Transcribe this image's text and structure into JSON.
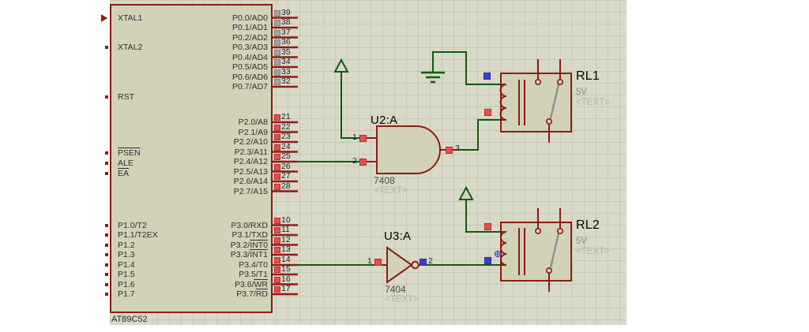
{
  "chip": {
    "part_label": "AT89C52",
    "left_pins": [
      {
        "label": "XTAL1"
      },
      {
        "label": "XTAL2"
      },
      {
        "label": "RST"
      },
      {
        "label": "PSEN"
      },
      {
        "label": "ALE"
      },
      {
        "label": "EA"
      },
      {
        "label": "P1.0/T2"
      },
      {
        "label": "P1.1/T2EX"
      },
      {
        "label": "P1.2"
      },
      {
        "label": "P1.3"
      },
      {
        "label": "P1.4"
      },
      {
        "label": "P1.5"
      },
      {
        "label": "P1.6"
      },
      {
        "label": "P1.7"
      }
    ],
    "right_pins": [
      {
        "num": "39",
        "pre": "P0.0/AD0",
        "ovl": ""
      },
      {
        "num": "38",
        "pre": "P0.1/AD1",
        "ovl": ""
      },
      {
        "num": "37",
        "pre": "P0.2/AD2",
        "ovl": ""
      },
      {
        "num": "36",
        "pre": "P0.3/AD3",
        "ovl": ""
      },
      {
        "num": "35",
        "pre": "P0.4/AD4",
        "ovl": ""
      },
      {
        "num": "34",
        "pre": "P0.5/AD5",
        "ovl": ""
      },
      {
        "num": "33",
        "pre": "P0.6/AD6",
        "ovl": ""
      },
      {
        "num": "32",
        "pre": "P0.7/AD7",
        "ovl": ""
      },
      {
        "num": "21",
        "pre": "P2.0/A8",
        "ovl": ""
      },
      {
        "num": "22",
        "pre": "P2.1/A9",
        "ovl": ""
      },
      {
        "num": "23",
        "pre": "P2.2/A10",
        "ovl": ""
      },
      {
        "num": "24",
        "pre": "P2.3/A11",
        "ovl": ""
      },
      {
        "num": "25",
        "pre": "P2.4/A12",
        "ovl": ""
      },
      {
        "num": "26",
        "pre": "P2.5/A13",
        "ovl": ""
      },
      {
        "num": "27",
        "pre": "P2.6/A14",
        "ovl": ""
      },
      {
        "num": "28",
        "pre": "P2.7/A15",
        "ovl": ""
      },
      {
        "num": "10",
        "pre": "P3.0/RXD",
        "ovl": ""
      },
      {
        "num": "11",
        "pre": "P3.1/TXD",
        "ovl": ""
      },
      {
        "num": "12",
        "pre": "P3.2/",
        "ovl": "INT0"
      },
      {
        "num": "13",
        "pre": "P3.3/",
        "ovl": "INT1"
      },
      {
        "num": "14",
        "pre": "P3.4/T0",
        "ovl": ""
      },
      {
        "num": "15",
        "pre": "P3.5/T1",
        "ovl": ""
      },
      {
        "num": "16",
        "pre": "P3.6/",
        "ovl": "WR"
      },
      {
        "num": "17",
        "pre": "P3.7/",
        "ovl": "RD"
      }
    ]
  },
  "gates": {
    "u2": {
      "ref": "U2:A",
      "part": "7408",
      "placeholder": "<TEXT>",
      "pin1": "1",
      "pin2": "2",
      "pin3": "3"
    },
    "u3": {
      "ref": "U3:A",
      "part": "7404",
      "placeholder": "<TEXT>",
      "pin1": "1",
      "pin2": "2"
    }
  },
  "relays": {
    "rl1": {
      "ref": "RL1",
      "voltage": "5V",
      "placeholder": "<TEXT>"
    },
    "rl2": {
      "ref": "RL2",
      "voltage": "5V",
      "placeholder": "<TEXT>"
    }
  },
  "colors": {
    "wire": "#0b5e0b",
    "component_outline": "#8b1c12",
    "component_fill": "#d2d2b9",
    "state_high": "#e84d4d",
    "state_low": "#3c3ccc",
    "state_float": "#a2a2a2"
  }
}
